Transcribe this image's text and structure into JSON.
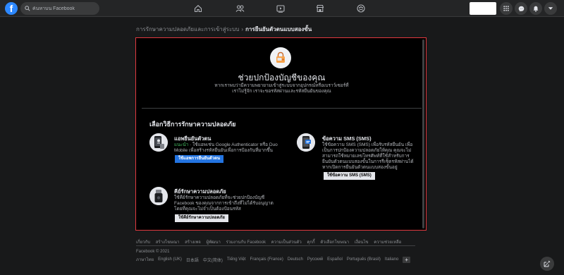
{
  "topbar": {
    "logo_letter": "f",
    "search_placeholder": "ค้นหาบน Facebook",
    "nav_icons": [
      "home-icon",
      "friends-icon",
      "watch-icon",
      "marketplace-icon",
      "groups-icon"
    ],
    "right_icons": [
      "menu-grid-icon",
      "messenger-icon",
      "notifications-icon",
      "account-dropdown-icon"
    ]
  },
  "breadcrumb": {
    "parent": "การรักษาความปลอดภัยและการเข้าสู่ระบบ",
    "separator": "›",
    "current": "การยืนยันตัวตนแบบสองขั้น"
  },
  "hero": {
    "title": "ช่วยปกป้องบัญชีของคุณ",
    "subtitle": "หากเราพบว่ามีความพยายามเข้าสู่ระบบจากอุปกรณ์หรือเบราว์เซอร์ที่เราไม่รู้จัก เราจะขอรหัสผ่านและรหัสยืนยันของคุณ"
  },
  "section_title": "เลือกวิธีการรักษาความปลอดภัย",
  "options": {
    "auth_app": {
      "title": "แอพยืนยันตัวตน",
      "recommended": "แนะนำ",
      "desc": " · ใช้แอพเช่น Google Authenticator หรือ Duo Mobile เพื่อสร้างรหัสยืนยันเพื่อการป้องกันที่มากขึ้น",
      "button": "ใช้แอพการยืนยันตัวตน"
    },
    "sms": {
      "title": "ข้อความ SMS (SMS)",
      "desc": "ใช้ข้อความ SMS (SMS) เพื่อรับรหัสยืนยัน เพื่อเป็นการปกป้องความปลอดภัยให้คุณ คุณจะไม่สามารถใช้หมายเลขโทรศัพท์ที่ใช้สำหรับการยืนยันตัวตนแบบสองขั้นในการรีเซ็ตรหัสผ่านได้หากเปิดการยืนยันตัวตนแบบสองขั้นอยู่",
      "button": "ใช้ข้อความ SMS (SMS)"
    },
    "security_key": {
      "title": "คีย์รักษาความปลอดภัย",
      "desc": "ใช้คีย์รักษาความปลอดภัยที่จะช่วยปกป้องบัญชี Facebook ของคุณจากการเข้าถึงที่ไม่ได้รับอนุญาต โดยที่คุณจะไม่จำเป็นต้องป้อนรหัส",
      "button": "ใช้คีย์รักษาความปลอดภัย"
    }
  },
  "footer": {
    "links": [
      "เกี่ยวกับ",
      "สร้างโฆษณา",
      "สร้างเพจ",
      "ผู้พัฒนา",
      "ร่วมงานกับ Facebook",
      "ความเป็นส่วนตัว",
      "คุกกี้",
      "ตัวเลือกโฆษณา",
      "เงื่อนไข",
      "ความช่วยเหลือ"
    ],
    "copyright": "Facebook © 2021",
    "languages": [
      "ภาษาไทย",
      "English (UK)",
      "日本語",
      "中文(简体)",
      "Tiếng Việt",
      "Français (France)",
      "Deutsch",
      "Русский",
      "Español",
      "Português (Brasil)",
      "Italiano"
    ],
    "more_languages": "+"
  },
  "colors": {
    "accent": "#2374e1",
    "panel_border": "#e0383e",
    "recommended": "#45bd62"
  }
}
